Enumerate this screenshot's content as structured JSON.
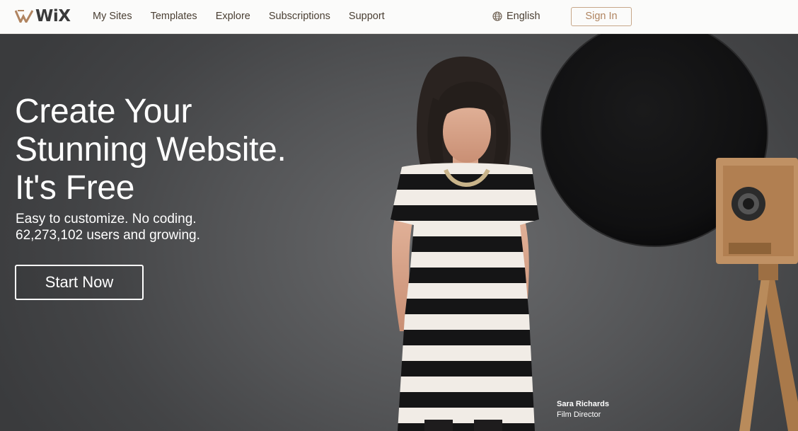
{
  "brand": {
    "name": "WiX",
    "colors": {
      "accent": "#b08460",
      "text": "#4a3f33",
      "bar": "#fbfbfa"
    }
  },
  "nav": {
    "items": [
      {
        "label": "My Sites"
      },
      {
        "label": "Templates"
      },
      {
        "label": "Explore"
      },
      {
        "label": "Subscriptions"
      },
      {
        "label": "Support"
      }
    ]
  },
  "language": {
    "label": "English",
    "icon": "globe-icon"
  },
  "signin": {
    "label": "Sign In"
  },
  "hero": {
    "headline": [
      "Create Your",
      "Stunning Website.",
      "It's Free"
    ],
    "subline": [
      "Easy to customize. No coding.",
      "62,273,102 users and growing."
    ],
    "cta": "Start Now",
    "caption": {
      "name": "Sara Richards",
      "role": "Film Director"
    }
  }
}
